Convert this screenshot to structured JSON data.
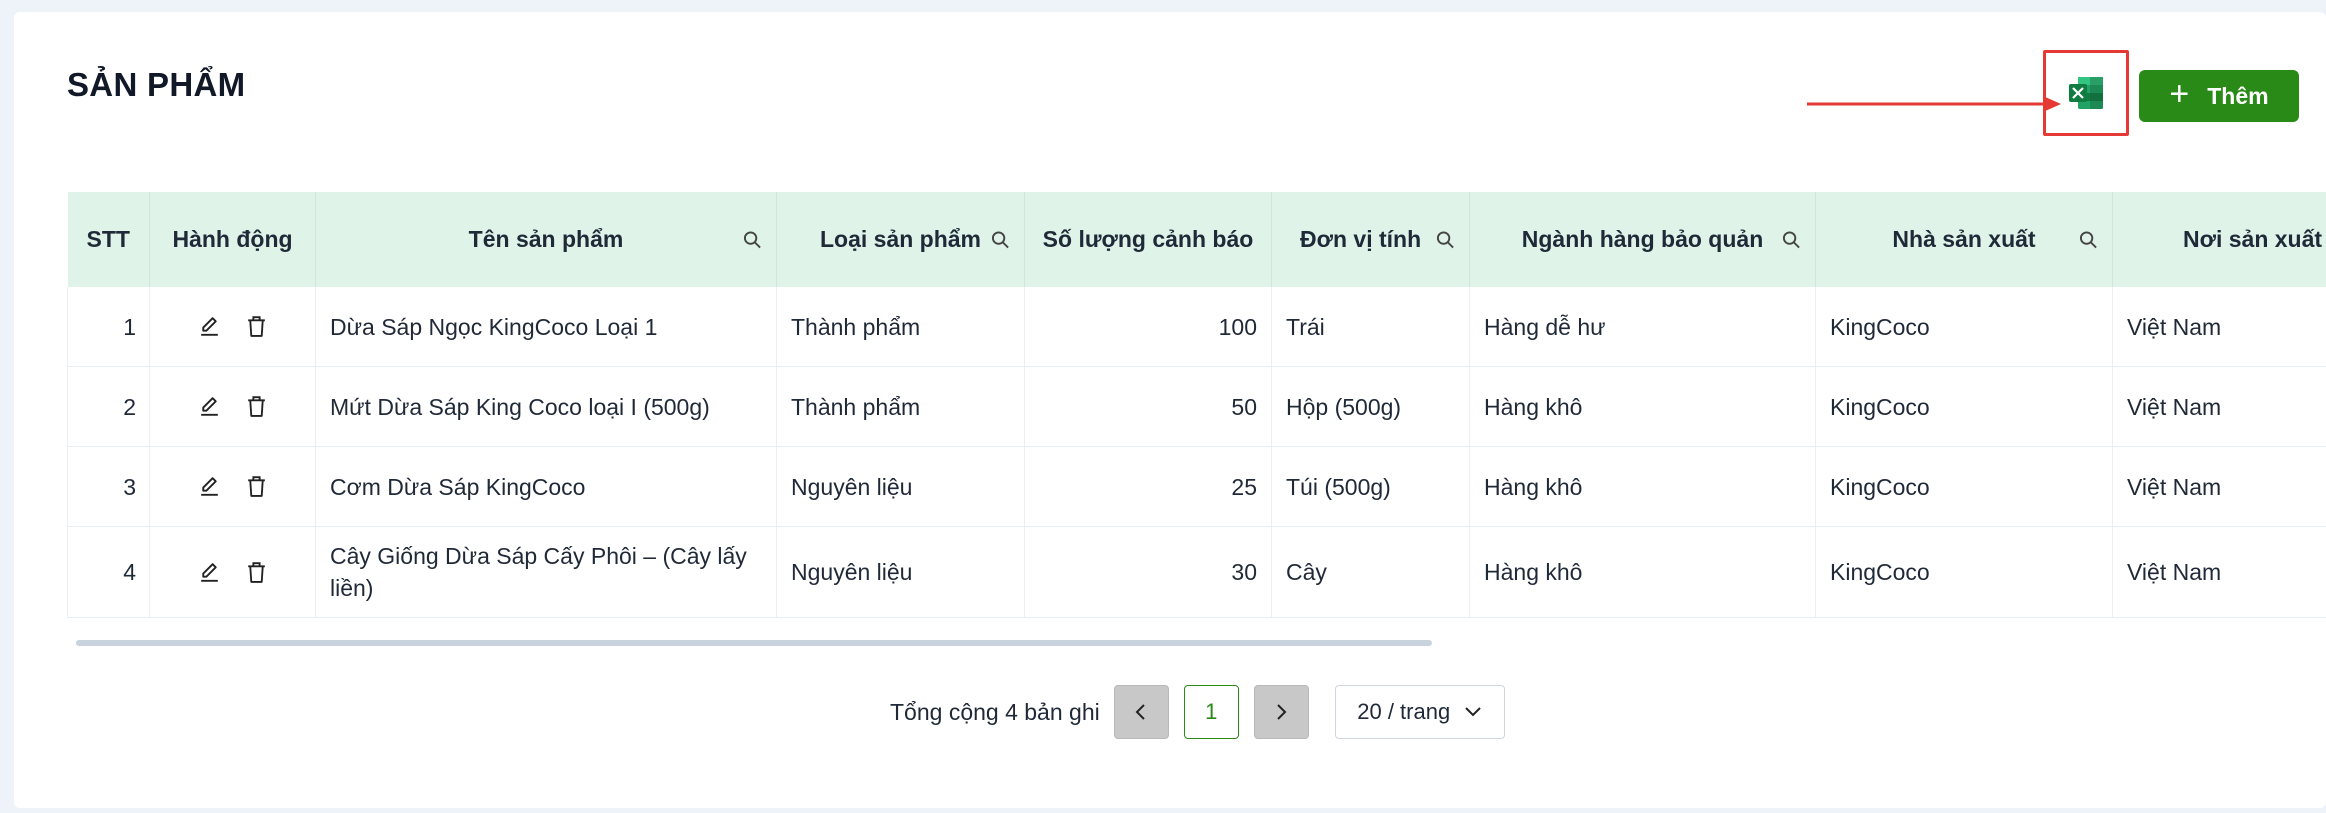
{
  "page": {
    "title": "SẢN PHẨM",
    "add_label": "Thêm",
    "export_icon": "excel-icon",
    "accent_color": "#2a8a17",
    "highlight_color": "#e53935"
  },
  "table": {
    "columns": [
      "STT",
      "Hành động",
      "Tên sản phẩm",
      "Loại sản phẩm",
      "Số lượng cảnh báo",
      "Đơn vị tính",
      "Ngành hàng bảo quản",
      "Nhà sản xuất",
      "Nơi sản xuất"
    ],
    "rows": [
      {
        "stt": "1",
        "name": "Dừa Sáp Ngọc KingCoco Loại 1",
        "type": "Thành phẩm",
        "qty": "100",
        "unit": "Trái",
        "category": "Hàng dễ hư",
        "maker": "KingCoco",
        "origin": "Việt Nam"
      },
      {
        "stt": "2",
        "name": "Mứt Dừa Sáp King Coco loại I (500g)",
        "type": "Thành phẩm",
        "qty": "50",
        "unit": "Hộp (500g)",
        "category": "Hàng khô",
        "maker": "KingCoco",
        "origin": "Việt Nam"
      },
      {
        "stt": "3",
        "name": "Cơm Dừa Sáp KingCoco",
        "type": "Nguyên liệu",
        "qty": "25",
        "unit": "Túi (500g)",
        "category": "Hàng khô",
        "maker": "KingCoco",
        "origin": "Việt Nam"
      },
      {
        "stt": "4",
        "name": "Cây Giống Dừa Sáp Cấy Phôi – (Cây lấy liền)",
        "type": "Nguyên liệu",
        "qty": "30",
        "unit": "Cây",
        "category": "Hàng khô",
        "maker": "KingCoco",
        "origin": "Việt Nam"
      }
    ]
  },
  "pagination": {
    "total_text": "Tổng cộng 4 bản ghi",
    "current_page": "1",
    "page_size": "20 / trang"
  }
}
